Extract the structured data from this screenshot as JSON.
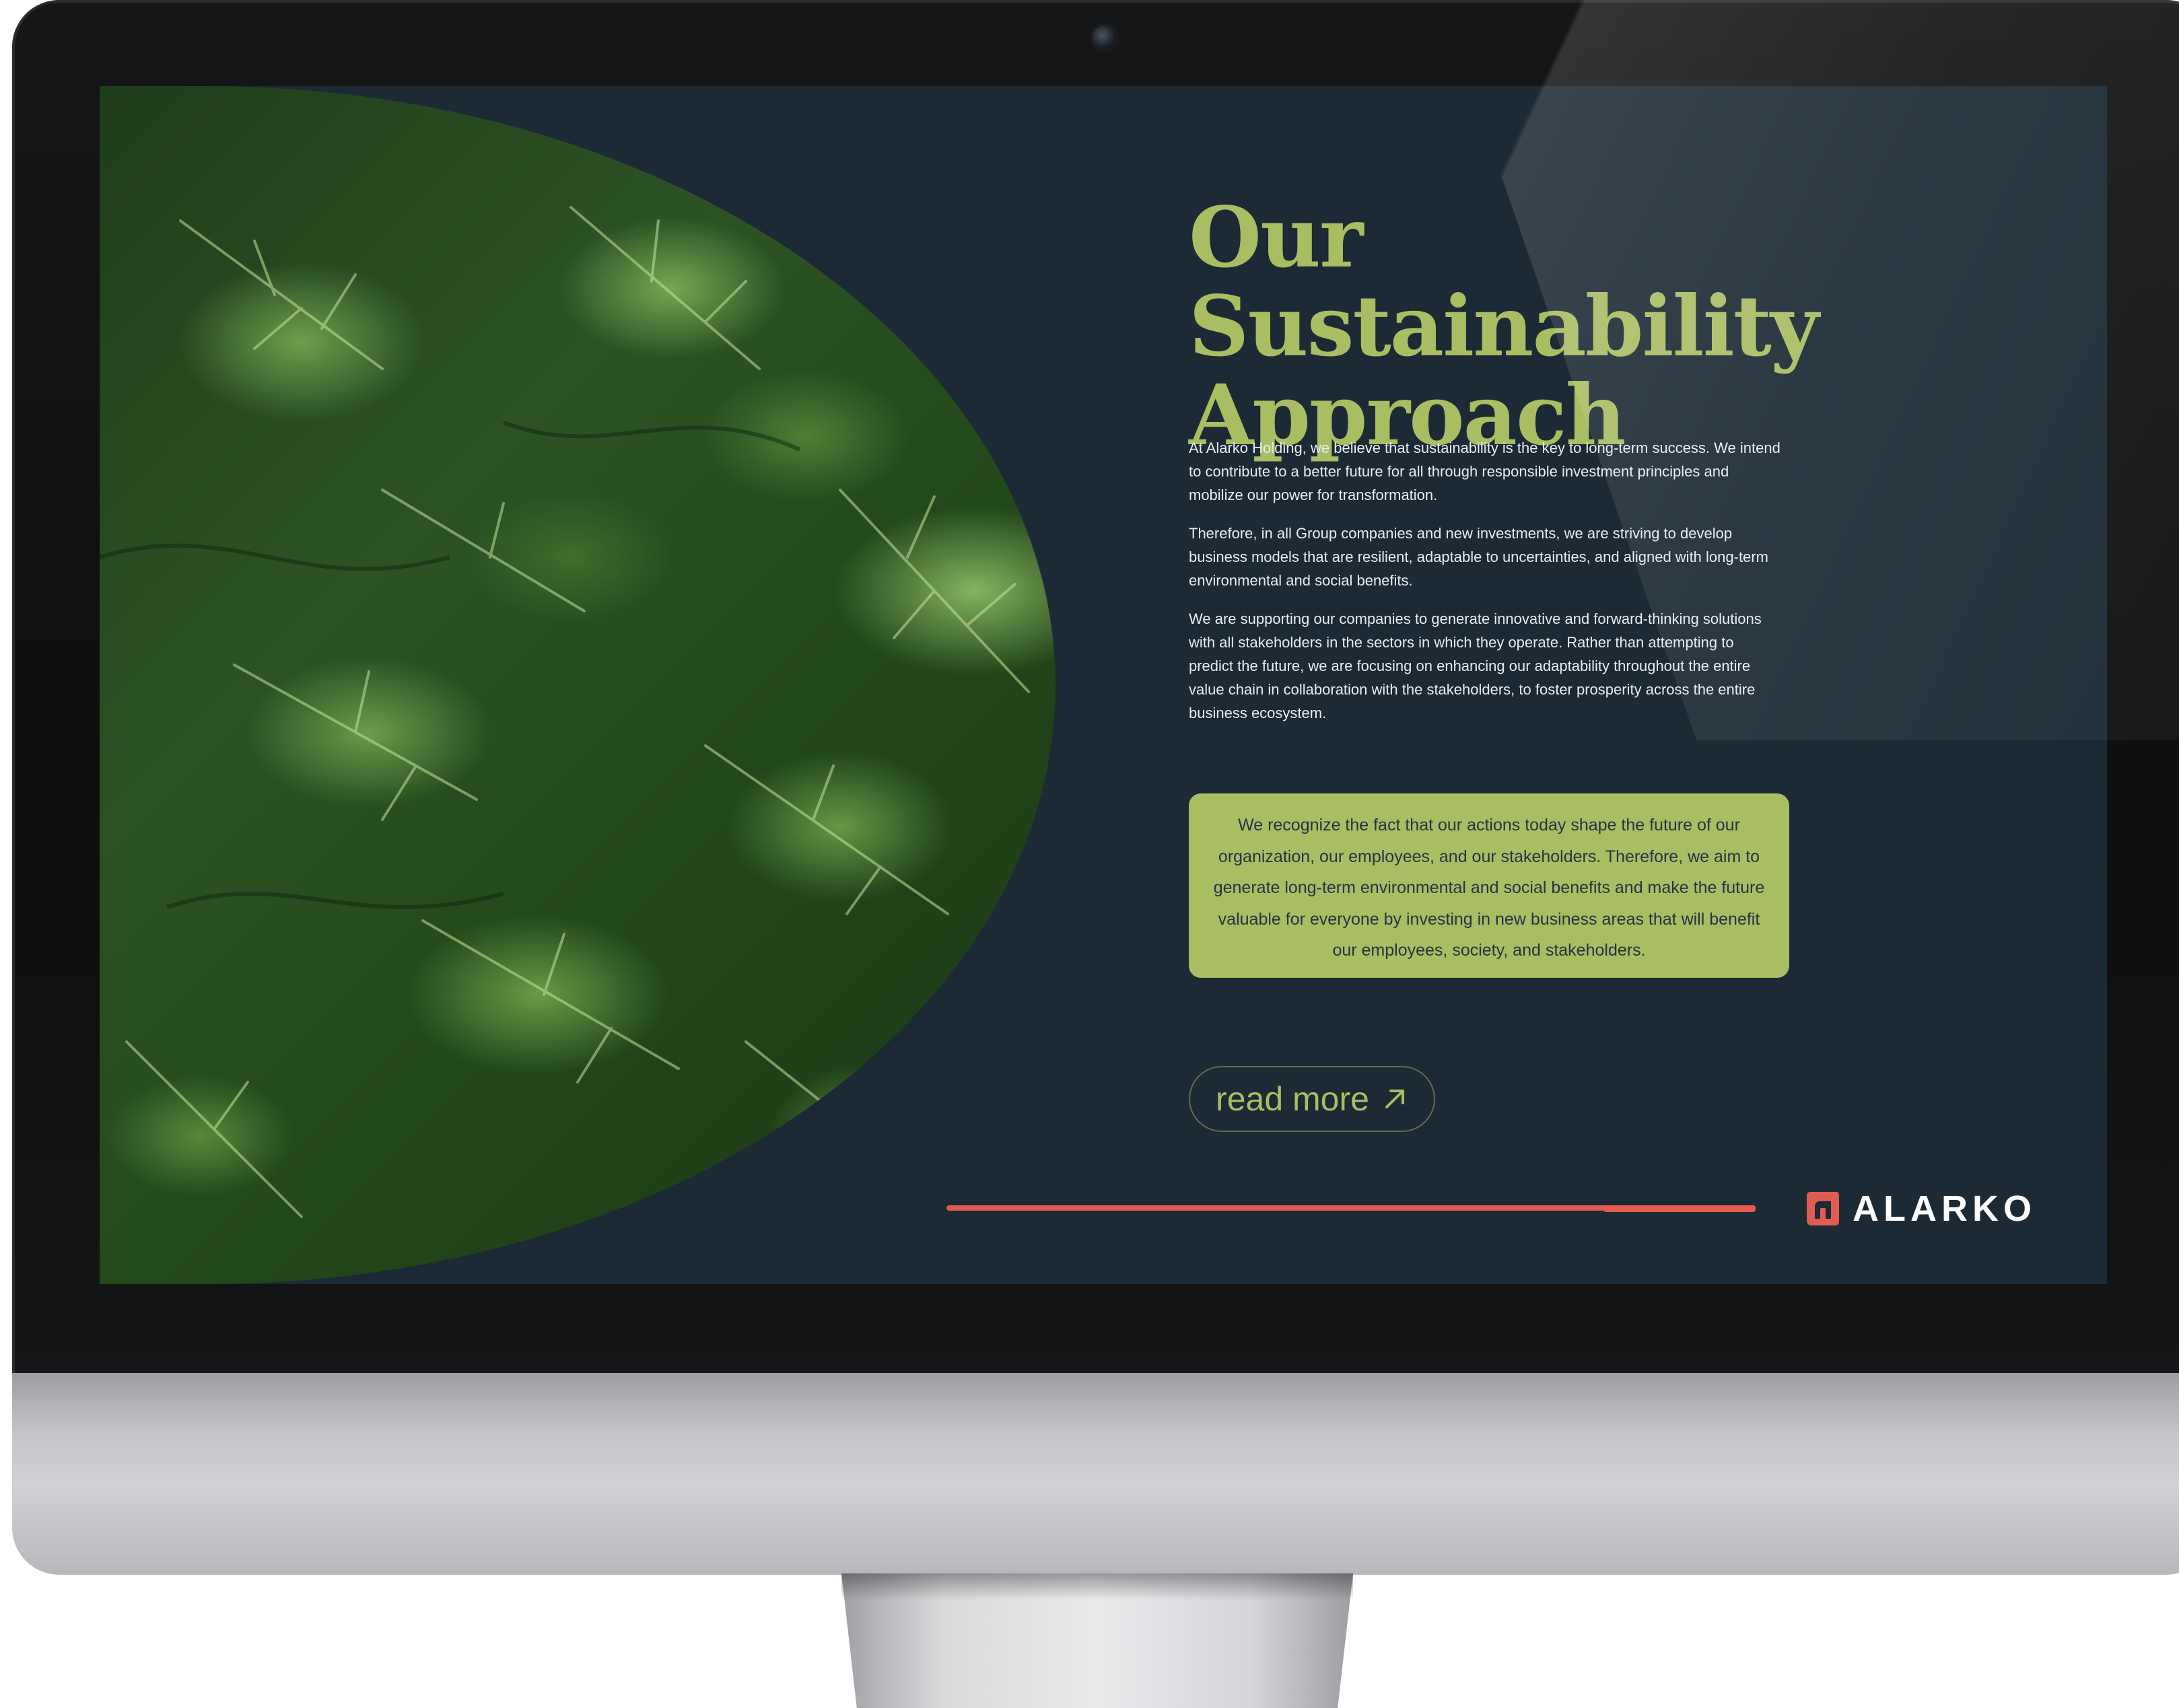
{
  "page": {
    "headline_line1": "Our Sustainability",
    "headline_line2": "Approach",
    "paragraphs": [
      "At Alarko Holding, we believe that sustainability is the key to long-term success. We intend to contribute to a better future for all through responsible investment principles and mobilize our power for transformation.",
      "Therefore, in all Group companies and new investments, we are striving to develop business models that are resilient, adaptable to uncertainties, and aligned with long-term environmental and social benefits.",
      "We are supporting our companies to generate innovative and forward-thinking solutions with all stakeholders in the sectors in which they operate. Rather than attempting to predict the future, we are focusing on enhancing our adaptability throughout the entire value chain in collaboration with the stakeholders, to foster prosperity across the entire business ecosystem."
    ],
    "callout_text": "We recognize the fact that our actions today shape the future of our organization, our employees, and our stakeholders. Therefore, we aim to generate long-term environmental and social benefits and make the future valuable for everyone by investing in new business areas that will benefit our employees, society, and stakeholders.",
    "read_more_label": "read more",
    "read_more_icon": "arrow-up-right-icon",
    "brand_name": "ALARKO",
    "brand_icon": "alarko-logo-mark"
  },
  "colors": {
    "screen_background": "#1b2a35",
    "accent_green": "#a9bd63",
    "accent_red": "#e05c52",
    "body_text": "#e8edf0",
    "callout_text": "#223543"
  }
}
